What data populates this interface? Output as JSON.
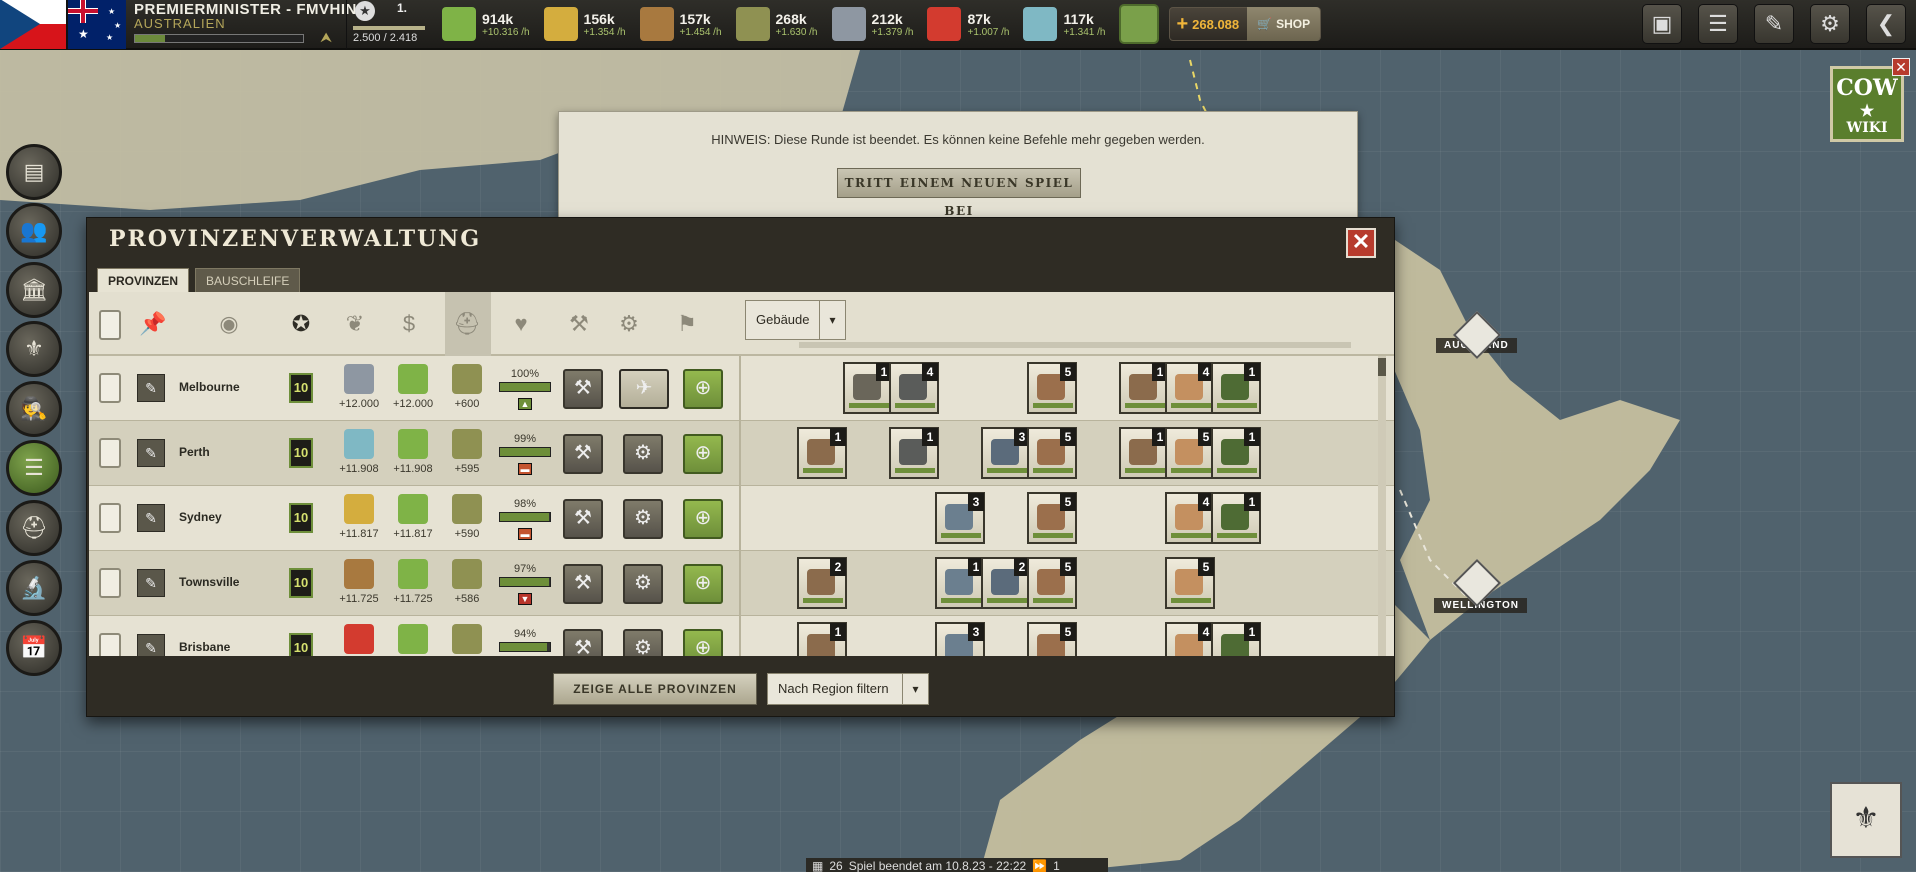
{
  "player": {
    "name": "PREMIERMINISTER - FMVHIN...",
    "country": "AUSTRALIEN",
    "rank": "1.",
    "points": "2.500 / 2.418"
  },
  "resources": [
    {
      "icon": "money-icon",
      "value": "914k",
      "rate": "+10.316 /h",
      "color": "#7fb347"
    },
    {
      "icon": "grain-icon",
      "value": "156k",
      "rate": "+1.354 /h",
      "color": "#d4ad3e"
    },
    {
      "icon": "crate-icon",
      "value": "157k",
      "rate": "+1.454 /h",
      "color": "#a8793f"
    },
    {
      "icon": "helmet-icon",
      "value": "268k",
      "rate": "+1.630 /h",
      "color": "#8f9152"
    },
    {
      "icon": "steel-icon",
      "value": "212k",
      "rate": "+1.379 /h",
      "color": "#8e97a2"
    },
    {
      "icon": "fuel-icon",
      "value": "87k",
      "rate": "+1.007 /h",
      "color": "#d33b2f"
    },
    {
      "icon": "rare-material-icon",
      "value": "117k",
      "rate": "+1.341 /h",
      "color": "#7fb8c4"
    }
  ],
  "gold": {
    "amount": "268.088",
    "shop_label": "SHOP"
  },
  "notice": {
    "message": "HINWEIS: Diese Runde ist beendet. Es können keine Befehle mehr gegeben werden.",
    "join_label": "TRITT EINEM NEUEN SPIEL BEI"
  },
  "dialog": {
    "title": "PROVINZENVERWALTUNG",
    "tabs": [
      "PROVINZEN",
      "BAUSCHLEIFE"
    ],
    "dropdown_label": "Gebäude",
    "show_all_label": "ZEIGE ALLE PROVINZEN",
    "region_filter_label": "Nach Region filtern"
  },
  "provinces": [
    {
      "name": "Melbourne",
      "morale": "10",
      "res1": {
        "icon": "steel-icon",
        "val": "+12.000",
        "color": "#8e97a2"
      },
      "res2": {
        "icon": "money-icon",
        "val": "+12.000",
        "color": "#7fb347"
      },
      "res3": {
        "icon": "helmet-icon",
        "val": "+600",
        "color": "#8f9152"
      },
      "percent": "100%",
      "trend": "up",
      "trend_color": "#6e8f3a",
      "production": "aircraft-icon",
      "buildings": [
        {
          "slot": 2,
          "level": "1",
          "icon": "recruiting-icon",
          "color": "#6a665a"
        },
        {
          "slot": 3,
          "level": "4",
          "icon": "airfield-icon",
          "color": "#5a5c5a"
        },
        {
          "slot": 6,
          "level": "5",
          "icon": "bunker-icon",
          "color": "#9b6f4c"
        },
        {
          "slot": 8,
          "level": "1",
          "icon": "factory-icon",
          "color": "#8b6b4c"
        },
        {
          "slot": 9,
          "level": "4",
          "icon": "bread-icon",
          "color": "#c49060"
        },
        {
          "slot": 10,
          "level": "1",
          "icon": "aa-gun-icon",
          "color": "#4e6b34"
        }
      ]
    },
    {
      "name": "Perth",
      "morale": "10",
      "res1": {
        "icon": "rare-material-icon",
        "val": "+11.908",
        "color": "#7fb8c4"
      },
      "res2": {
        "icon": "money-icon",
        "val": "+11.908",
        "color": "#7fb347"
      },
      "res3": {
        "icon": "helmet-icon",
        "val": "+595",
        "color": "#8f9152"
      },
      "percent": "99%",
      "trend": "flat",
      "trend_color": "#c4542f",
      "production": "gear-icon",
      "buildings": [
        {
          "slot": 1,
          "level": "1",
          "icon": "barracks-icon",
          "color": "#8b6b4c"
        },
        {
          "slot": 3,
          "level": "1",
          "icon": "airfield-icon",
          "color": "#5a5c5a"
        },
        {
          "slot": 5,
          "level": "3",
          "icon": "hq-icon",
          "color": "#5b6b7b"
        },
        {
          "slot": 6,
          "level": "5",
          "icon": "bunker-icon",
          "color": "#9b6f4c"
        },
        {
          "slot": 8,
          "level": "1",
          "icon": "factory-icon",
          "color": "#8b6b4c"
        },
        {
          "slot": 9,
          "level": "5",
          "icon": "bread-icon",
          "color": "#c49060"
        },
        {
          "slot": 10,
          "level": "1",
          "icon": "aa-gun-icon",
          "color": "#4e6b34"
        }
      ]
    },
    {
      "name": "Sydney",
      "morale": "10",
      "res1": {
        "icon": "grain-icon",
        "val": "+11.817",
        "color": "#d4ad3e"
      },
      "res2": {
        "icon": "money-icon",
        "val": "+11.817",
        "color": "#7fb347"
      },
      "res3": {
        "icon": "helmet-icon",
        "val": "+590",
        "color": "#8f9152"
      },
      "percent": "98%",
      "trend": "flat",
      "trend_color": "#c4542f",
      "production": "gear-icon",
      "buildings": [
        {
          "slot": 4,
          "level": "3",
          "icon": "naval-base-icon",
          "color": "#6b7f8f"
        },
        {
          "slot": 6,
          "level": "5",
          "icon": "bunker-icon",
          "color": "#9b6f4c"
        },
        {
          "slot": 9,
          "level": "4",
          "icon": "bread-icon",
          "color": "#c49060"
        },
        {
          "slot": 10,
          "level": "1",
          "icon": "aa-gun-icon",
          "color": "#4e6b34"
        }
      ]
    },
    {
      "name": "Townsville",
      "morale": "10",
      "res1": {
        "icon": "crate-icon",
        "val": "+11.725",
        "color": "#a8793f"
      },
      "res2": {
        "icon": "money-icon",
        "val": "+11.725",
        "color": "#7fb347"
      },
      "res3": {
        "icon": "helmet-icon",
        "val": "+586",
        "color": "#8f9152"
      },
      "percent": "97%",
      "trend": "down",
      "trend_color": "#b8352a",
      "production": "gear-icon",
      "buildings": [
        {
          "slot": 1,
          "level": "2",
          "icon": "barracks-icon",
          "color": "#8b6b4c"
        },
        {
          "slot": 4,
          "level": "1",
          "icon": "naval-base-icon",
          "color": "#6b7f8f"
        },
        {
          "slot": 5,
          "level": "2",
          "icon": "hq-icon",
          "color": "#5b6b7b"
        },
        {
          "slot": 6,
          "level": "5",
          "icon": "bunker-icon",
          "color": "#9b6f4c"
        },
        {
          "slot": 9,
          "level": "5",
          "icon": "bread-icon",
          "color": "#c49060"
        }
      ]
    },
    {
      "name": "Brisbane",
      "morale": "10",
      "res1": {
        "icon": "fuel-icon",
        "val": "",
        "color": "#d33b2f"
      },
      "res2": {
        "icon": "money-icon",
        "val": "",
        "color": "#7fb347"
      },
      "res3": {
        "icon": "helmet-icon",
        "val": "",
        "color": "#8f9152"
      },
      "percent": "94%",
      "trend": "",
      "trend_color": "#6e8f3a",
      "production": "gear-icon",
      "buildings": [
        {
          "slot": 1,
          "level": "1",
          "icon": "barracks-icon",
          "color": "#8b6b4c"
        },
        {
          "slot": 4,
          "level": "3",
          "icon": "naval-base-icon",
          "color": "#6b7f8f"
        },
        {
          "slot": 6,
          "level": "5",
          "icon": "bunker-icon",
          "color": "#9b6f4c"
        },
        {
          "slot": 9,
          "level": "4",
          "icon": "bread-icon",
          "color": "#c49060"
        },
        {
          "slot": 10,
          "level": "1",
          "icon": "aa-gun-icon",
          "color": "#4e6b34"
        }
      ]
    }
  ],
  "map": {
    "labels": [
      "AUCKLAND",
      "WELLINGTON"
    ]
  },
  "wiki": {
    "line1": "COW",
    "line2": "WIKI"
  },
  "footer": {
    "day": "26",
    "text": "Spiel beendet am 10.8.23 - 22:22",
    "speed": "1"
  }
}
